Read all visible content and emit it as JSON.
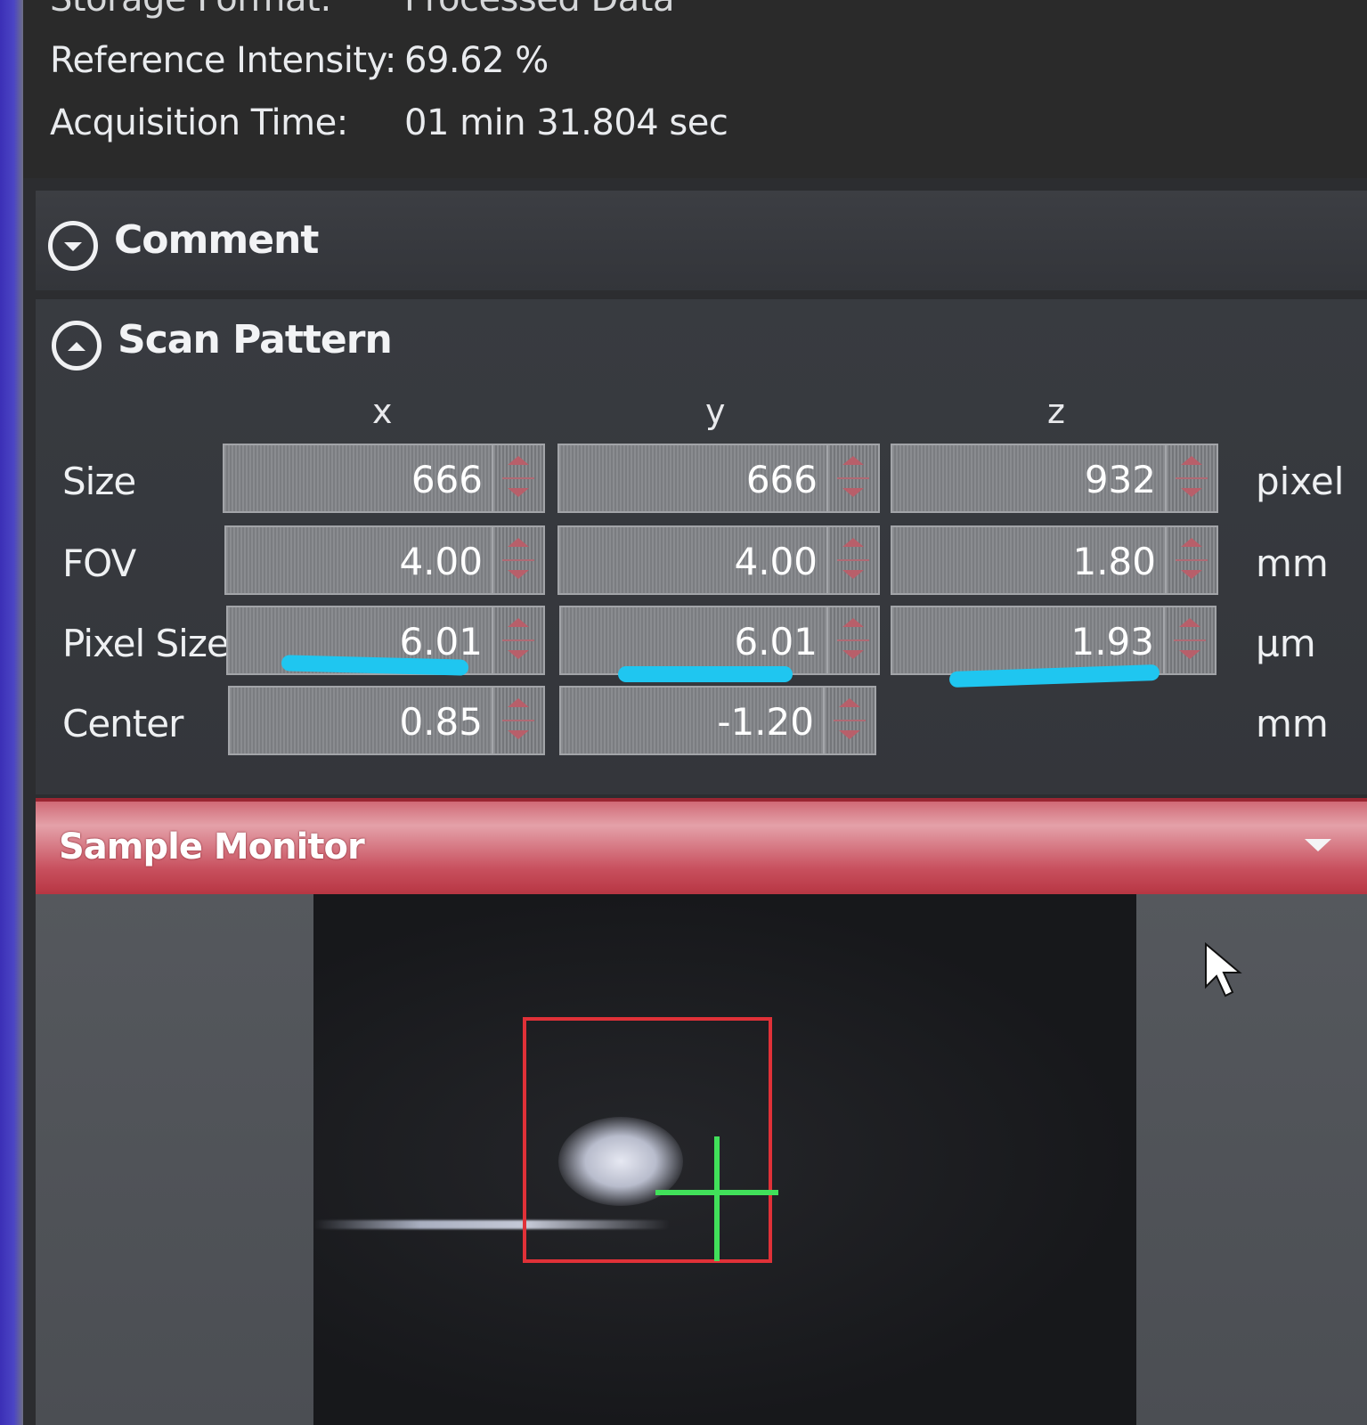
{
  "info": {
    "storage_label": "Storage Format:",
    "storage_value": "Processed Data",
    "ref_label": "Reference Intensity:",
    "ref_value": "69.62 %",
    "acq_label": "Acquisition Time:",
    "acq_value": "01 min 31.804 sec"
  },
  "comment": {
    "title": "Comment",
    "icon": "chevron-down-circle-icon"
  },
  "scan_pattern": {
    "title": "Scan Pattern",
    "icon": "chevron-up-circle-icon",
    "columns": [
      "x",
      "y",
      "z"
    ],
    "rows": [
      {
        "label": "Size",
        "unit": "pixel",
        "x": "666",
        "y": "666",
        "z": "932"
      },
      {
        "label": "FOV",
        "unit": "mm",
        "x": "4.00",
        "y": "4.00",
        "z": "1.80"
      },
      {
        "label": "Pixel Size",
        "unit": "µm",
        "x": "6.01",
        "y": "6.01",
        "z": "1.93"
      },
      {
        "label": "Center",
        "unit": "mm",
        "x": "0.85",
        "y": "-1.20",
        "z": ""
      }
    ],
    "highlight_color": "#1fc6f0"
  },
  "sample_monitor": {
    "title": "Sample Monitor",
    "roi_color": "#e03138",
    "crosshair_color": "#41e05a"
  },
  "colors": {
    "panel": "#34363b",
    "header_red": "#c8505e"
  }
}
